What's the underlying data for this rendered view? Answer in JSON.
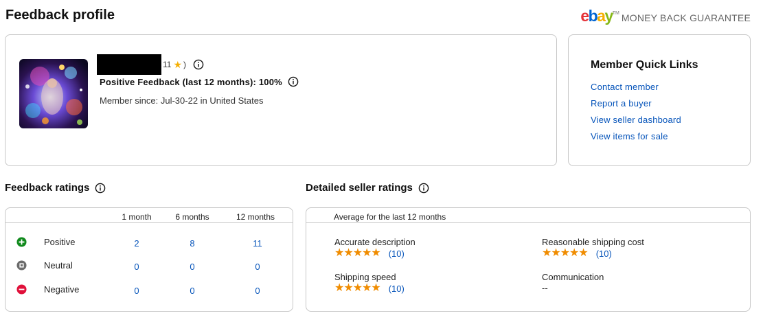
{
  "header": {
    "title": "Feedback profile",
    "logo_letters": [
      "e",
      "b",
      "a",
      "y"
    ],
    "tm": "TM",
    "guarantee": "MONEY BACK GUARANTEE"
  },
  "profile": {
    "feedback_score": "11",
    "star": "★",
    "close_paren": ")",
    "positive_feedback": "Positive Feedback (last 12 months): 100%",
    "member_since": "Member since: Jul-30-22 in United States"
  },
  "quick_links": {
    "title": "Member Quick Links",
    "items": [
      "Contact member",
      "Report a buyer",
      "View seller dashboard",
      "View items for sale"
    ]
  },
  "feedback_ratings": {
    "title": "Feedback ratings",
    "columns": [
      "1 month",
      "6 months",
      "12 months"
    ],
    "rows": [
      {
        "label": "Positive",
        "icon": "plus-circle-icon",
        "color": "#118a1d",
        "values": [
          "2",
          "8",
          "11"
        ]
      },
      {
        "label": "Neutral",
        "icon": "neutral-square-icon",
        "color": "#6b6b6b",
        "values": [
          "0",
          "0",
          "0"
        ]
      },
      {
        "label": "Negative",
        "icon": "minus-circle-icon",
        "color": "#e0103a",
        "values": [
          "0",
          "0",
          "0"
        ]
      }
    ]
  },
  "seller_ratings": {
    "title": "Detailed seller ratings",
    "subtitle": "Average for the last 12 months",
    "items": [
      {
        "label": "Accurate description",
        "stars": 5,
        "count": "(10)"
      },
      {
        "label": "Reasonable shipping cost",
        "stars": 5,
        "count": "(10)"
      },
      {
        "label": "Shipping speed",
        "stars": 5,
        "count": "(10)"
      },
      {
        "label": "Communication",
        "value": "--"
      }
    ]
  },
  "colors": {
    "link": "#0654ba",
    "star": "#f08c00",
    "border": "#c7c7c7"
  }
}
